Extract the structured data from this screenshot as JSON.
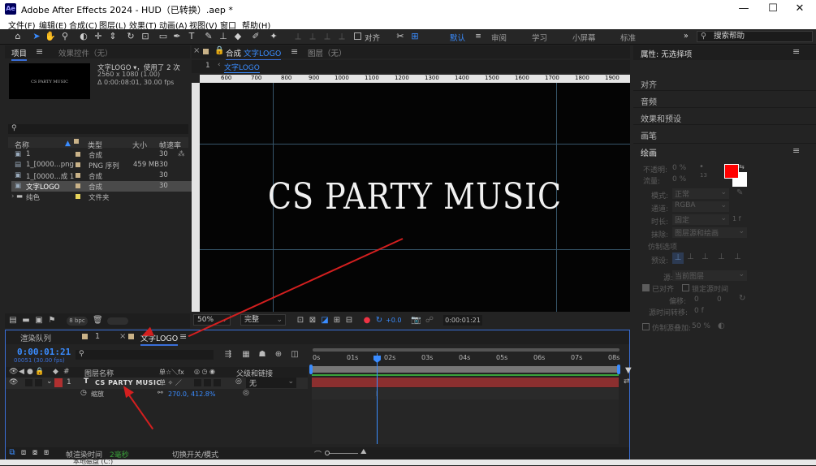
{
  "app": {
    "logo": "Ae",
    "title": "Adobe After Effects 2024 - HUD（已转换）.aep *"
  },
  "window_controls": {
    "minimize": "—",
    "maximize": "☐",
    "close": "✕"
  },
  "menu": [
    "文件(F)",
    "编辑(E)",
    "合成(C)",
    "图层(L)",
    "效果(T)",
    "动画(A)",
    "视图(V)",
    "窗口",
    "帮助(H)"
  ],
  "toolbar": {
    "snap_label": "对齐",
    "workspaces": [
      "默认",
      "审阅",
      "学习",
      "小屏幕",
      "标准"
    ],
    "more": "»",
    "search_placeholder": "搜索帮助"
  },
  "project": {
    "tabs": [
      "项目",
      "效果控件（无）"
    ],
    "preview": {
      "thumb_text": "CS PARTY MUSIC",
      "name": "文字LOGO",
      "usage": "▾，使用了 2 次",
      "size": "2560 x 1080 (1.00)",
      "duration": "Δ 0:00:08:01, 30.00 fps"
    },
    "search_icon": "⚲",
    "columns": [
      "名称",
      "类型",
      "大小",
      "帧速率"
    ],
    "rows": [
      {
        "name": "1",
        "type": "合成",
        "size": "",
        "fps": "30",
        "color": "#c9b288"
      },
      {
        "name": "1_[0000...png",
        "type": "PNG 序列",
        "size": "459 MB",
        "fps": "30",
        "color": "#c9b288"
      },
      {
        "name": "1_[0000...成 1",
        "type": "合成",
        "size": "",
        "fps": "30",
        "color": "#c9b288"
      },
      {
        "name": "文字LOGO",
        "type": "合成",
        "size": "",
        "fps": "30",
        "color": "#c9b288"
      },
      {
        "name": "纯色",
        "type": "文件夹",
        "size": "",
        "fps": "",
        "color": "#e6d35a"
      }
    ],
    "bpc": "8 bpc"
  },
  "comp": {
    "tab_prefix": "合成",
    "tab_name": "文字LOGO",
    "layer_tab": "图层（无）",
    "nav_num": "1",
    "breadcrumb": "文字LOGO",
    "ruler": [
      "600",
      "700",
      "800",
      "900",
      "1000",
      "1100",
      "1200",
      "1300",
      "1400",
      "1500",
      "1600",
      "1700",
      "1800",
      "1900"
    ],
    "text": "CS PARTY MUSIC",
    "zoom": "50%",
    "quality": "完整",
    "exposure": "+0.0",
    "timecode": "0:00:01:21"
  },
  "timeline": {
    "tabs": [
      "渲染队列",
      "1",
      "文字LOGO"
    ],
    "current_time": "0:00:01:21",
    "frame_info": "00051 (30.00 fps)",
    "ruler": [
      "0s",
      "01s",
      "02s",
      "03s",
      "04s",
      "05s",
      "06s",
      "07s",
      "08s"
    ],
    "headers": {
      "layer_name": "图层名称",
      "switches": "单☆＼fx",
      "parent": "父级和链接"
    },
    "layer": {
      "num": "1",
      "type_icon": "T",
      "name": "CS PARTY MUSIC",
      "parent": "无"
    },
    "property": {
      "name": "缩放",
      "value": "270.0, 412.8%"
    },
    "footer": {
      "render_time_label": "帧渲染时间",
      "render_time": "2毫秒",
      "toggle": "切换开关/模式"
    }
  },
  "properties": {
    "title": "属性: 无选择项",
    "sections": [
      "对齐",
      "音频",
      "效果和预设",
      "画笔"
    ],
    "paint": {
      "title": "绘画",
      "opacity_label": "不透明:",
      "opacity": "0 %",
      "flow_label": "流量:",
      "flow": "0 %",
      "brush_size": "13",
      "mode_label": "模式:",
      "mode": "正常",
      "channel_label": "通道:",
      "channel": "RGBA",
      "duration_label": "时长:",
      "duration": "固定",
      "erase_label": "抹除:",
      "erase": "图层源和绘画",
      "clone_label": "仿制选项",
      "preset_label": "预设:",
      "source_label": "源:",
      "source": "当前图层",
      "aligned": "已对齐",
      "lock_time": "锁定源时间",
      "offset_label": "偏移:",
      "offset_x": "0",
      "offset_y": "0",
      "time_shift_label": "源时间转移:",
      "time_shift": "0 f",
      "overlay_label": "仿制源叠加:",
      "overlay": "50 %",
      "fg_color": "#ff0000",
      "bg_color": "#ffffff"
    }
  },
  "bottom_hint": "本地磁盘 (C:)"
}
